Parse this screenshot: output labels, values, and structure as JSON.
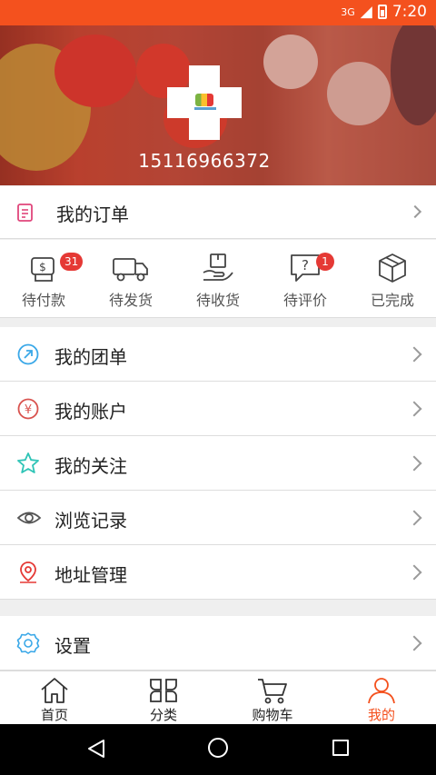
{
  "status_bar": {
    "network": "3G",
    "time": "7:20"
  },
  "profile": {
    "phone": "15116966372"
  },
  "orders": {
    "title": "我的订单",
    "statuses": [
      {
        "label": "待付款",
        "icon": "payment-icon",
        "badge": "31"
      },
      {
        "label": "待发货",
        "icon": "truck-icon",
        "badge": ""
      },
      {
        "label": "待收货",
        "icon": "receive-box-icon",
        "badge": ""
      },
      {
        "label": "待评价",
        "icon": "review-icon",
        "badge": "1"
      },
      {
        "label": "已完成",
        "icon": "package-icon",
        "badge": ""
      }
    ]
  },
  "menu": [
    {
      "label": "我的团单",
      "icon": "group-order-icon",
      "color": "#3aa8e8"
    },
    {
      "label": "我的账户",
      "icon": "yuan-icon",
      "color": "#d9534f"
    },
    {
      "label": "我的关注",
      "icon": "star-icon",
      "color": "#2ec4b6"
    },
    {
      "label": "浏览记录",
      "icon": "eye-icon",
      "color": "#555555"
    },
    {
      "label": "地址管理",
      "icon": "location-pin-icon",
      "color": "#e53935"
    }
  ],
  "settings": {
    "label": "设置",
    "icon": "gear-icon",
    "color": "#3aa8e8"
  },
  "tabs": [
    {
      "label": "首页",
      "icon": "home-icon"
    },
    {
      "label": "分类",
      "icon": "category-icon"
    },
    {
      "label": "购物车",
      "icon": "cart-icon"
    },
    {
      "label": "我的",
      "icon": "user-icon",
      "active": true
    }
  ],
  "colors": {
    "accent": "#f4511e",
    "badge": "#e53935"
  }
}
